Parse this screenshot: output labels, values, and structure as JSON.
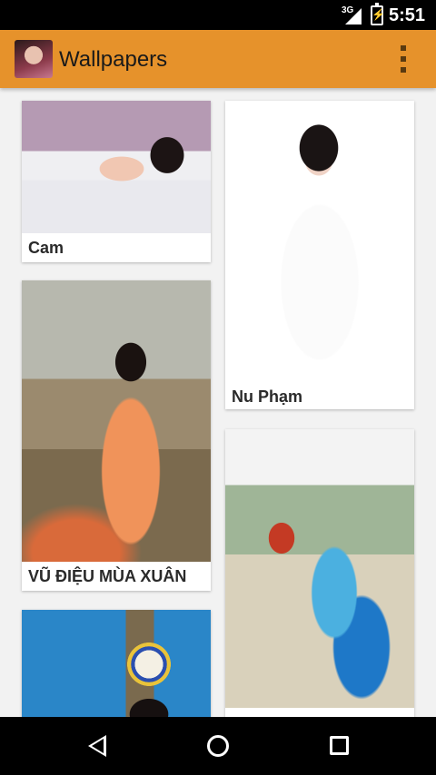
{
  "status_bar": {
    "network": "3G",
    "time": "5:51",
    "icons": [
      "signal-icon",
      "battery-charging-icon"
    ]
  },
  "app_bar": {
    "title": "Wallpapers",
    "icon": "app-avatar-icon",
    "menu_icon": "overflow-menu-icon"
  },
  "wallpapers": [
    {
      "label": "Cam",
      "image": "bedroom-photo"
    },
    {
      "label": "Nu Phạm",
      "image": "white-dress-photo"
    },
    {
      "label": "VŨ ĐIỆU MÙA XUÂN",
      "image": "orange-dancer-photo"
    },
    {
      "label": "",
      "image": "blue-dancer-photo"
    },
    {
      "label": "",
      "image": "volleyball-photo"
    }
  ],
  "nav_bar": {
    "icons": [
      "back-icon",
      "home-icon",
      "recent-apps-icon"
    ]
  }
}
